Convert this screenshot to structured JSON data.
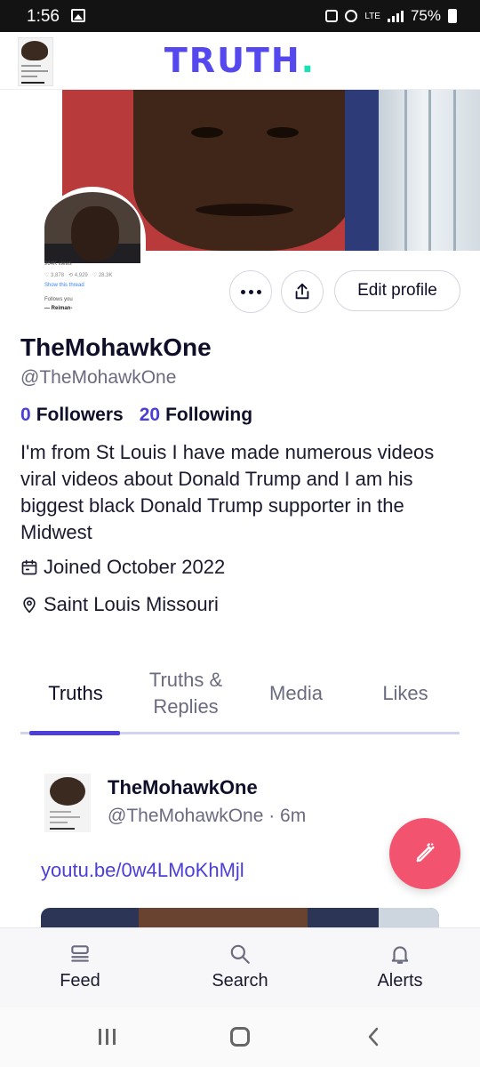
{
  "status_bar": {
    "time": "1:56",
    "network": "LTE",
    "battery": "75%"
  },
  "header": {
    "logo_text": "TRUTH",
    "logo_dot": ".",
    "brand_color": "#5448ee",
    "accent_color": "#17e2b6"
  },
  "profile": {
    "display_name": "TheMohawkOne",
    "handle": "@TheMohawkOne",
    "followers_count": "0",
    "followers_label": "Followers",
    "following_count": "20",
    "following_label": "Following",
    "bio": "I'm from St Louis I have made numerous videos viral videos about Donald Trump and I am his biggest black Donald Trump supporter in the Midwest",
    "joined": "Joined October 2022",
    "location": "Saint Louis Missouri",
    "edit_label": "Edit profile"
  },
  "tabs": [
    {
      "label": "Truths",
      "active": true
    },
    {
      "label": "Truths & Replies",
      "active": false
    },
    {
      "label": "Media",
      "active": false
    },
    {
      "label": "Likes",
      "active": false
    }
  ],
  "post": {
    "author": "TheMohawkOne",
    "meta": "@TheMohawkOne · 6m",
    "link": "youtu.be/0w4LMoKhMjl"
  },
  "bottom_nav": {
    "feed": "Feed",
    "search": "Search",
    "alerts": "Alerts"
  },
  "colors": {
    "link": "#4b3fd8",
    "fab": "#f2546f",
    "text": "#0f0f2a",
    "muted": "#6b6b80"
  },
  "icons": [
    "image-icon",
    "alarm-icon",
    "signal-icon",
    "battery-icon",
    "more-icon",
    "share-icon",
    "calendar-icon",
    "location-pin-icon",
    "compose-icon",
    "feed-icon",
    "search-icon",
    "bell-icon",
    "recents-icon",
    "home-icon",
    "back-icon"
  ]
}
